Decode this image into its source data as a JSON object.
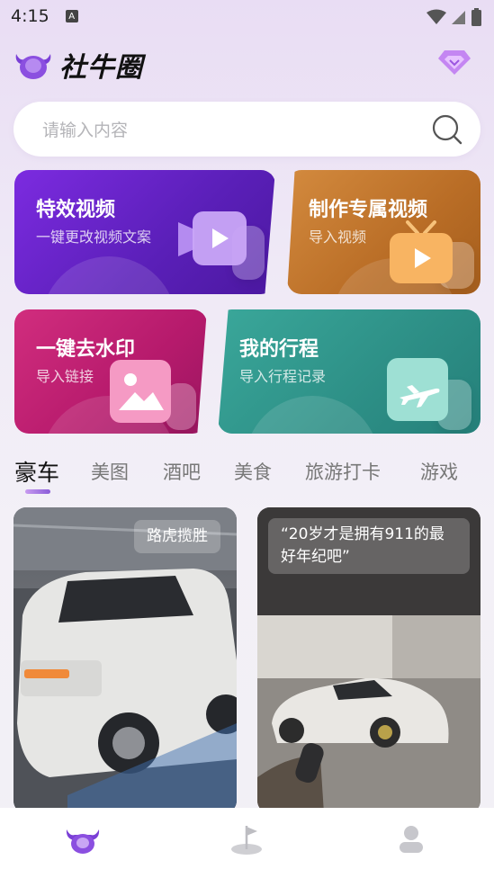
{
  "status": {
    "time": "4:15",
    "notif": "A"
  },
  "header": {
    "app_name": "社牛圈"
  },
  "search": {
    "placeholder": "请输入内容"
  },
  "cards": [
    {
      "title": "特效视频",
      "subtitle": "一键更改视频文案"
    },
    {
      "title": "制作专属视频",
      "subtitle": "导入视频"
    },
    {
      "title": "一键去水印",
      "subtitle": "导入链接"
    },
    {
      "title": "我的行程",
      "subtitle": "导入行程记录"
    }
  ],
  "tabs": [
    "豪车",
    "美图",
    "酒吧",
    "美食",
    "旅游打卡",
    "游戏"
  ],
  "posts": [
    {
      "caption": "路虎揽胜"
    },
    {
      "caption_line1": "“20岁才是拥有911的最",
      "caption_line2": "好年纪吧”"
    }
  ],
  "colors": {
    "accent": "#8a5cd8",
    "card_purple": "#6a24cc",
    "card_orange": "#c47a2f",
    "card_pink": "#c4207a",
    "card_teal": "#33998f"
  }
}
